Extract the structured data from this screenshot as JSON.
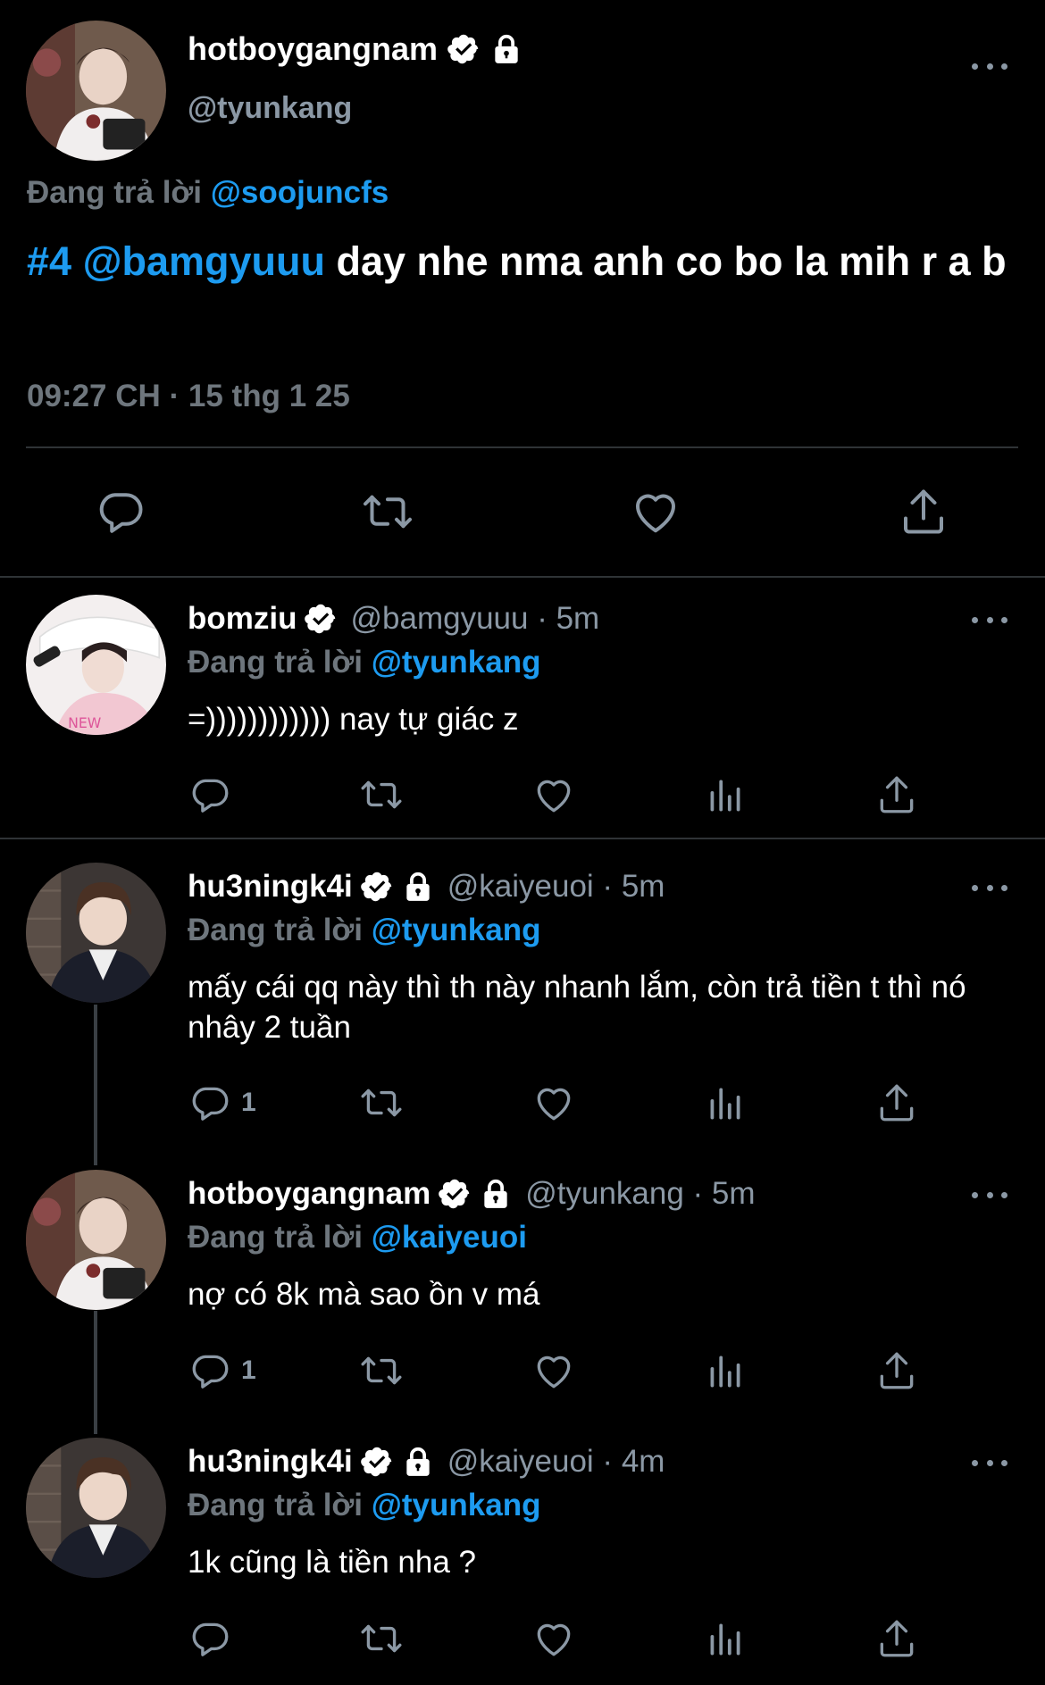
{
  "colors": {
    "accent": "#1d9bf0",
    "background": "#000000",
    "muted": "#6e767d",
    "divider": "#2f3336"
  },
  "main": {
    "name": "hotboygangnam",
    "handle": "@tyunkang",
    "replying_prefix": "Đang trả lời",
    "replying_to": "@soojuncfs",
    "text_hashtag": "#4",
    "text_mention": "@bamgyuuu",
    "text_body": " day nhe nma anh co bo la mih r a b",
    "time": "09:27 CH · 15 thg 1 25",
    "icons": [
      "verified-icon",
      "lock-icon",
      "more-icon",
      "reply-icon",
      "retweet-icon",
      "like-icon",
      "share-icon"
    ]
  },
  "replies": [
    {
      "name": "bomziu",
      "handle": "@bamgyuuu",
      "time": "5m",
      "replying_prefix": "Đang trả lời",
      "replying_to": "@tyunkang",
      "text": "=)))))))))))) nay tự giác z",
      "reply_count": "",
      "locked": false
    },
    {
      "name": "hu3ningk4i",
      "handle": "@kaiyeuoi",
      "time": "5m",
      "replying_prefix": "Đang trả lời",
      "replying_to": "@tyunkang",
      "text": "mấy cái qq này thì th này nhanh lắm, còn trả tiền t thì nó nhây 2 tuần",
      "reply_count": "1",
      "locked": true
    },
    {
      "name": "hotboygangnam",
      "handle": "@tyunkang",
      "time": "5m",
      "replying_prefix": "Đang trả lời",
      "replying_to": "@kaiyeuoi",
      "text": "nợ có 8k mà sao ồn v má",
      "reply_count": "1",
      "locked": true
    },
    {
      "name": "hu3ningk4i",
      "handle": "@kaiyeuoi",
      "time": "4m",
      "replying_prefix": "Đang trả lời",
      "replying_to": "@tyunkang",
      "text": "1k cũng là tiền nha ?",
      "reply_count": "",
      "locked": true
    }
  ],
  "separator": " · "
}
